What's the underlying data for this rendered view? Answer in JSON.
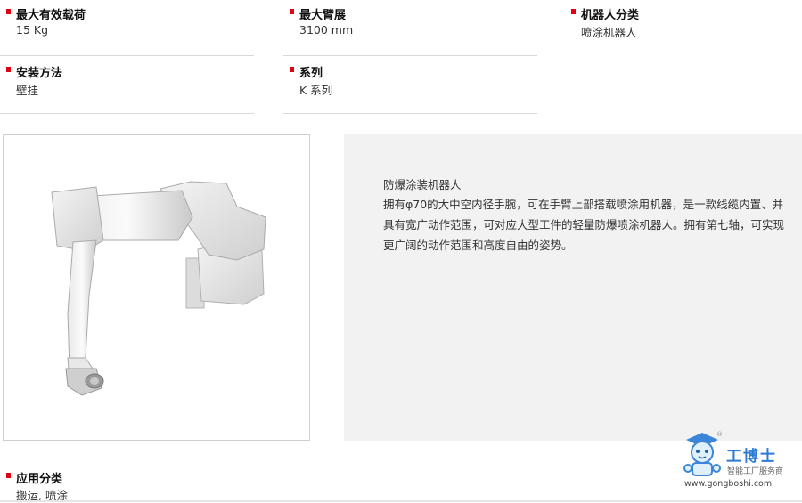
{
  "specs": {
    "payload": {
      "label": "最大有效载荷",
      "value": "15 Kg"
    },
    "reach": {
      "label": "最大臂展",
      "value": "3100 mm"
    },
    "category": {
      "label": "机器人分类",
      "value": "喷涂机器人"
    },
    "mounting": {
      "label": "安装方法",
      "value": "壁挂"
    },
    "series": {
      "label": "系列",
      "value": "K 系列"
    }
  },
  "description": {
    "title": "防爆涂装机器人",
    "body": "拥有φ70的大中空内径手腕，可在手臂上部搭载喷涂用机器，是一款线缆内置、并具有宽广动作范围，可对应大型工件的轻量防爆喷涂机器人。拥有第七轴，可实现更广阔的动作范围和高度自由的姿势。"
  },
  "application": {
    "label": "应用分类",
    "value": "搬运, 喷涂"
  },
  "watermark": {
    "name": "工博士",
    "subtitle": "智能工厂服务商",
    "url": "www.gongboshi.com",
    "registered": "®"
  }
}
